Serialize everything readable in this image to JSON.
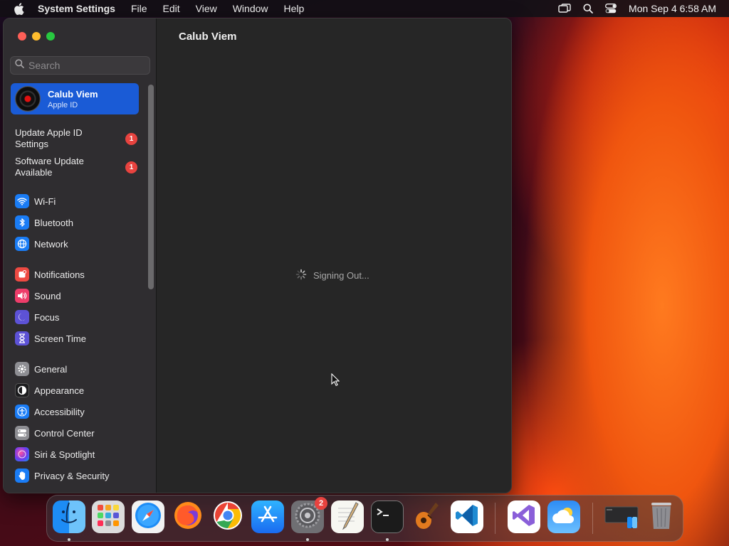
{
  "menubar": {
    "app_name": "System Settings",
    "items": [
      "File",
      "Edit",
      "View",
      "Window",
      "Help"
    ],
    "clock": "Mon Sep 4  6:58 AM"
  },
  "sidebar": {
    "search_placeholder": "Search",
    "account": {
      "name": "Calub Viem",
      "subtitle": "Apple ID"
    },
    "notices": [
      {
        "label": "Update Apple ID Settings",
        "badge": "1"
      },
      {
        "label": "Software Update Available",
        "badge": "1"
      }
    ],
    "items": [
      {
        "label": "Wi-Fi",
        "icon": "wifi-icon",
        "color": "#1a7cf5"
      },
      {
        "label": "Bluetooth",
        "icon": "bluetooth-icon",
        "color": "#1a7cf5"
      },
      {
        "label": "Network",
        "icon": "globe-icon",
        "color": "#1a7cf5"
      },
      {
        "label": "Notifications",
        "icon": "bell-icon",
        "color": "#ee4a42"
      },
      {
        "label": "Sound",
        "icon": "speaker-icon",
        "color": "#ee3d6a"
      },
      {
        "label": "Focus",
        "icon": "moon-icon",
        "color": "#5d52d6"
      },
      {
        "label": "Screen Time",
        "icon": "hourglass-icon",
        "color": "#5d52d6"
      },
      {
        "label": "General",
        "icon": "gear-icon",
        "color": "#8e8e93"
      },
      {
        "label": "Appearance",
        "icon": "appearance-icon",
        "color": "#1c1c1e"
      },
      {
        "label": "Accessibility",
        "icon": "accessibility-icon",
        "color": "#1a7cf5"
      },
      {
        "label": "Control Center",
        "icon": "control-center-icon",
        "color": "#8e8e93"
      },
      {
        "label": "Siri & Spotlight",
        "icon": "siri-icon",
        "color": "#2d2d6e"
      },
      {
        "label": "Privacy & Security",
        "icon": "hand-icon",
        "color": "#1a7cf5"
      }
    ]
  },
  "main": {
    "title": "Calub Viem",
    "status": "Signing Out..."
  },
  "dock": {
    "apps": [
      {
        "name": "Finder",
        "icon": "finder-icon",
        "running": true
      },
      {
        "name": "Launchpad",
        "icon": "launchpad-icon",
        "running": false
      },
      {
        "name": "Safari",
        "icon": "safari-icon",
        "running": false
      },
      {
        "name": "Firefox",
        "icon": "firefox-icon",
        "running": false
      },
      {
        "name": "Chrome",
        "icon": "chrome-icon",
        "running": false
      },
      {
        "name": "App Store",
        "icon": "app-store-icon",
        "running": false
      },
      {
        "name": "System Settings",
        "icon": "system-settings-icon",
        "running": true,
        "badge": "2"
      },
      {
        "name": "TextEdit",
        "icon": "textedit-icon",
        "running": false
      },
      {
        "name": "Terminal",
        "icon": "terminal-icon",
        "running": true
      },
      {
        "name": "GarageBand",
        "icon": "garageband-icon",
        "running": false
      },
      {
        "name": "Visual Studio Code",
        "icon": "vscode-icon",
        "running": false
      },
      {
        "name": "Visual Studio",
        "icon": "visual-studio-icon",
        "running": false
      },
      {
        "name": "Weather",
        "icon": "weather-icon",
        "running": false
      },
      {
        "name": "Finder Window",
        "icon": "finder-window-icon",
        "running": false
      },
      {
        "name": "Trash",
        "icon": "trash-icon",
        "running": false
      }
    ]
  }
}
